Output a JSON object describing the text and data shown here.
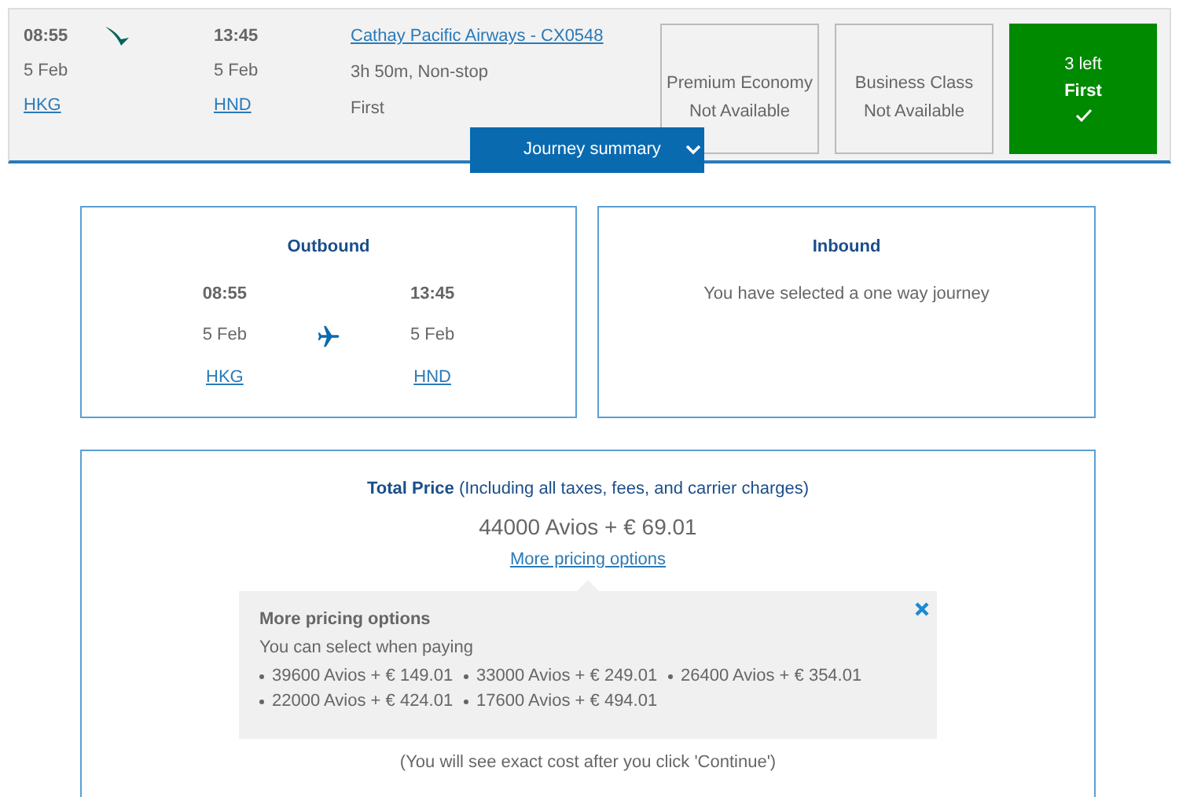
{
  "flight": {
    "depart": {
      "time": "08:55",
      "date": "5 Feb",
      "airport": "HKG"
    },
    "arrive": {
      "time": "13:45",
      "date": "5 Feb",
      "airport": "HND"
    },
    "airline_link": "Cathay Pacific Airways - CX0548",
    "duration": "3h 50m, Non-stop",
    "cabin": "First"
  },
  "fares": [
    {
      "name": "Premium Economy",
      "status": "Not Available",
      "selected": false
    },
    {
      "name": "Business Class",
      "status": "Not Available",
      "selected": false
    },
    {
      "name": "First",
      "status": "3 left",
      "selected": true
    }
  ],
  "journey_summary_button": {
    "label": "Journey summary",
    "expanded": true
  },
  "outbound": {
    "title": "Outbound",
    "depart": {
      "time": "08:55",
      "date": "5 Feb",
      "airport": "HKG"
    },
    "arrive": {
      "time": "13:45",
      "date": "5 Feb",
      "airport": "HND"
    }
  },
  "inbound": {
    "title": "Inbound",
    "message": "You have selected a one way journey"
  },
  "price": {
    "label": "**Total Price** (Including all taxes, fees, and carrier charges)",
    "amount": "44000 Avios + € 69.01",
    "more_link": "More pricing options",
    "popover": {
      "title": "More pricing options",
      "subtitle": "You can select when paying",
      "options": [
        "39600 Avios + € 149.01",
        "33000 Avios + € 249.01",
        "26400 Avios + € 354.01",
        "22000 Avios + € 424.01",
        "17600 Avios + € 494.01"
      ]
    },
    "note": "(You will see exact cost after you click 'Continue')"
  }
}
